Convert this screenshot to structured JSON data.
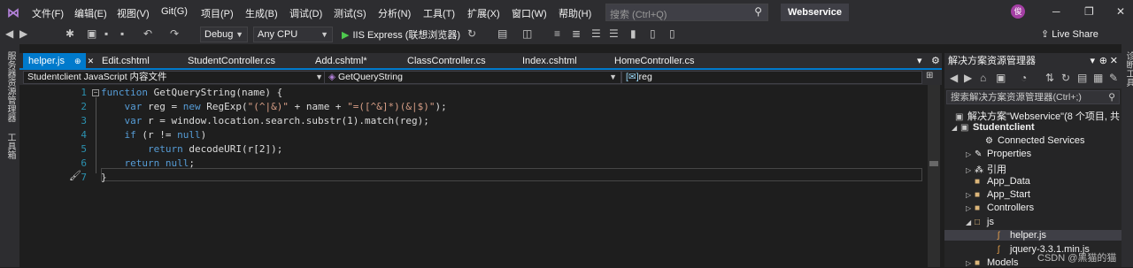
{
  "menu": [
    "文件(F)",
    "编辑(E)",
    "视图(V)",
    "Git(G)",
    "项目(P)",
    "生成(B)",
    "调试(D)",
    "测试(S)",
    "分析(N)",
    "工具(T)",
    "扩展(X)",
    "窗口(W)",
    "帮助(H)"
  ],
  "search": {
    "placeholder": "搜索 (Ctrl+Q)"
  },
  "solution_name": "Webservice",
  "avatar_initial": "俊",
  "toolbar": {
    "config": "Debug",
    "platform": "Any CPU",
    "run_label": "IIS Express (联想浏览器)",
    "live_share": "Live Share"
  },
  "left_strip": {
    "server_explorer": "服务器资源管理器",
    "toolbox": "工具箱"
  },
  "tabs": [
    "helper.js",
    "Edit.cshtml",
    "StudentController.cs",
    "Add.cshtml*",
    "ClassController.cs",
    "Index.cshtml",
    "HomeController.cs"
  ],
  "navbar": {
    "project": "Studentclient JavaScript 内容文件",
    "member": "GetQueryString",
    "variable": "reg"
  },
  "code_lines": [
    {
      "n": "1",
      "text": "function GetQueryString(name) {"
    },
    {
      "n": "2",
      "text": "    var reg = new RegExp(\"(^|&)\" + name + \"=([^&]*)(&|$)\");"
    },
    {
      "n": "3",
      "text": "    var r = window.location.search.substr(1).match(reg);"
    },
    {
      "n": "4",
      "text": "    if (r != null)"
    },
    {
      "n": "5",
      "text": "        return decodeURI(r[2]);"
    },
    {
      "n": "6",
      "text": "    return null;"
    },
    {
      "n": "7",
      "text": "}"
    }
  ],
  "solution_explorer": {
    "title": "解决方案资源管理器",
    "search_placeholder": "搜索解决方案资源管理器(Ctrl+;)",
    "items": [
      {
        "label": "解决方案\"Webservice\"(8 个项目, 共"
      },
      {
        "label": "Studentclient"
      },
      {
        "label": "Connected Services"
      },
      {
        "label": "Properties"
      },
      {
        "label": "引用"
      },
      {
        "label": "App_Data"
      },
      {
        "label": "App_Start"
      },
      {
        "label": "Controllers"
      },
      {
        "label": "js"
      },
      {
        "label": "helper.js"
      },
      {
        "label": "jquery-3.3.1.min.js"
      },
      {
        "label": "Models"
      }
    ]
  },
  "right_strip": {
    "label": "诊断工具"
  },
  "watermark": "CSDN @黑猫的猫"
}
